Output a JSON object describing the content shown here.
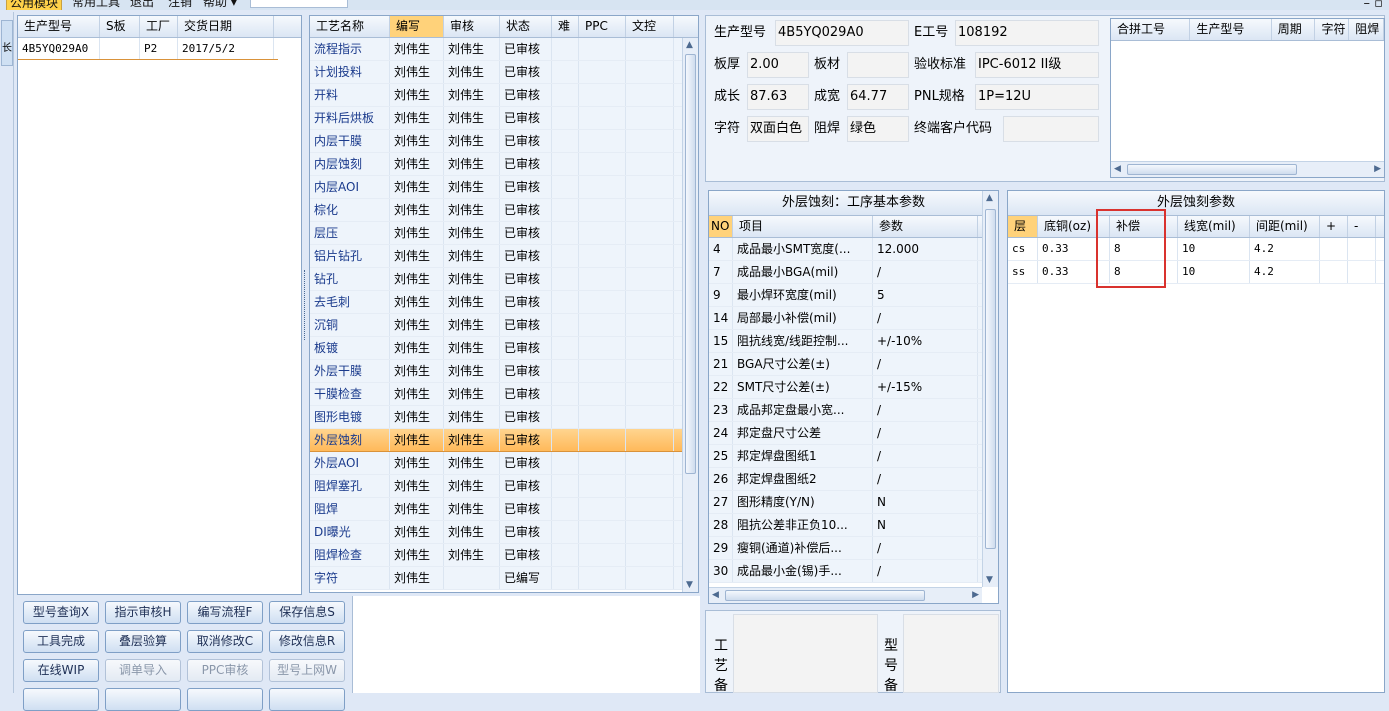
{
  "menu": {
    "items": [
      "公用模块",
      "常用工具",
      "退出",
      "注销",
      "帮助 ▾"
    ],
    "window_buttons": "– ▫"
  },
  "left_tab": "长",
  "model_list": {
    "columns": [
      "生产型号",
      "S板",
      "工厂",
      "交货日期"
    ],
    "rows": [
      [
        "4B5YQ029A0",
        "",
        "P2",
        "2017/5/2"
      ]
    ]
  },
  "process_list": {
    "columns": [
      "工艺名称",
      "编写",
      "审核",
      "状态",
      "难",
      "PPC",
      "文控"
    ],
    "rows": [
      [
        "流程指示",
        "刘伟生",
        "刘伟生",
        "已审核"
      ],
      [
        "计划投料",
        "刘伟生",
        "刘伟生",
        "已审核"
      ],
      [
        "开料",
        "刘伟生",
        "刘伟生",
        "已审核"
      ],
      [
        "开料后烘板",
        "刘伟生",
        "刘伟生",
        "已审核"
      ],
      [
        "内层干膜",
        "刘伟生",
        "刘伟生",
        "已审核"
      ],
      [
        "内层蚀刻",
        "刘伟生",
        "刘伟生",
        "已审核"
      ],
      [
        "内层AOI",
        "刘伟生",
        "刘伟生",
        "已审核"
      ],
      [
        "棕化",
        "刘伟生",
        "刘伟生",
        "已审核"
      ],
      [
        "层压",
        "刘伟生",
        "刘伟生",
        "已审核"
      ],
      [
        "铝片钻孔",
        "刘伟生",
        "刘伟生",
        "已审核"
      ],
      [
        "钻孔",
        "刘伟生",
        "刘伟生",
        "已审核"
      ],
      [
        "去毛刺",
        "刘伟生",
        "刘伟生",
        "已审核"
      ],
      [
        "沉铜",
        "刘伟生",
        "刘伟生",
        "已审核"
      ],
      [
        "板镀",
        "刘伟生",
        "刘伟生",
        "已审核"
      ],
      [
        "外层干膜",
        "刘伟生",
        "刘伟生",
        "已审核"
      ],
      [
        "干膜检查",
        "刘伟生",
        "刘伟生",
        "已审核"
      ],
      [
        "图形电镀",
        "刘伟生",
        "刘伟生",
        "已审核"
      ],
      [
        "外层蚀刻",
        "刘伟生",
        "刘伟生",
        "已审核"
      ],
      [
        "外层AOI",
        "刘伟生",
        "刘伟生",
        "已审核"
      ],
      [
        "阻焊塞孔",
        "刘伟生",
        "刘伟生",
        "已审核"
      ],
      [
        "阻焊",
        "刘伟生",
        "刘伟生",
        "已审核"
      ],
      [
        "DI曝光",
        "刘伟生",
        "刘伟生",
        "已审核"
      ],
      [
        "阻焊检查",
        "刘伟生",
        "刘伟生",
        "已审核"
      ],
      [
        "字符",
        "刘伟生",
        "",
        "已编写"
      ]
    ],
    "selected_index": 17
  },
  "buttons": [
    {
      "label": "型号查询X",
      "enabled": true
    },
    {
      "label": "指示审核H",
      "enabled": true
    },
    {
      "label": "编写流程F",
      "enabled": true
    },
    {
      "label": "保存信息S",
      "enabled": true
    },
    {
      "label": "工具完成",
      "enabled": true
    },
    {
      "label": "叠层验算",
      "enabled": true
    },
    {
      "label": "取消修改C",
      "enabled": true
    },
    {
      "label": "修改信息R",
      "enabled": true
    },
    {
      "label": "在线WIP",
      "enabled": true
    },
    {
      "label": "调单导入",
      "enabled": false
    },
    {
      "label": "PPC审核",
      "enabled": false
    },
    {
      "label": "型号上网W",
      "enabled": false
    }
  ],
  "info": {
    "model_label": "生产型号",
    "model_value": "4B5YQ029A0",
    "e_label": "E工号",
    "e_value": "108192",
    "thickness_label": "板厚",
    "thickness_value": "2.00",
    "material_label": "板材",
    "material_value": "",
    "standard_label": "验收标准",
    "standard_value": "IPC-6012 II级",
    "length_label": "成长",
    "length_value": "87.63",
    "width_label": "成宽",
    "width_value": "64.77",
    "pnl_label": "PNL规格",
    "pnl_value": "1P=12U",
    "char_label": "字符",
    "char_value": "双面白色",
    "mask_label": "阻焊",
    "mask_value": "绿色",
    "customer_label": "终端客户代码",
    "customer_value": ""
  },
  "merge_grid": {
    "columns": [
      "合拼工号",
      "生产型号",
      "周期",
      "字符",
      "阻焊"
    ]
  },
  "param_panel": {
    "title": "外层蚀刻：工序基本参数",
    "columns": [
      "NO",
      "项目",
      "参数"
    ],
    "rows": [
      [
        "4",
        "成品最小SMT宽度(...",
        "12.000"
      ],
      [
        "7",
        "成品最小BGA(mil)",
        "/"
      ],
      [
        "9",
        "最小焊环宽度(mil)",
        "5"
      ],
      [
        "14",
        "局部最小补偿(mil)",
        "/"
      ],
      [
        "15",
        "阻抗线宽/线距控制...",
        "+/-10%"
      ],
      [
        "21",
        "BGA尺寸公差(±)",
        "/"
      ],
      [
        "22",
        "SMT尺寸公差(±)",
        "+/-15%"
      ],
      [
        "23",
        "成品邦定盘最小宽...",
        "/"
      ],
      [
        "24",
        "邦定盘尺寸公差",
        "/"
      ],
      [
        "25",
        "邦定焊盘图纸1",
        "/"
      ],
      [
        "26",
        "邦定焊盘图纸2",
        "/"
      ],
      [
        "27",
        "图形精度(Y/N)",
        "N"
      ],
      [
        "28",
        "阻抗公差非正负10...",
        "N"
      ],
      [
        "29",
        "瘦铜(通道)补偿后...",
        "/"
      ],
      [
        "30",
        "成品最小金(锡)手...",
        "/"
      ]
    ]
  },
  "etch_panel": {
    "title": "外层蚀刻参数",
    "columns": [
      "层",
      "底铜(oz)",
      "补偿",
      "线宽(mil)",
      "间距(mil)",
      "+",
      "-"
    ],
    "rows": [
      [
        "cs",
        "0.33",
        "8",
        "10",
        "4.2",
        "",
        ""
      ],
      [
        "ss",
        "0.33",
        "8",
        "10",
        "4.2",
        "",
        ""
      ]
    ]
  },
  "notes": {
    "process_label": "工艺备",
    "model_label": "型号备"
  }
}
